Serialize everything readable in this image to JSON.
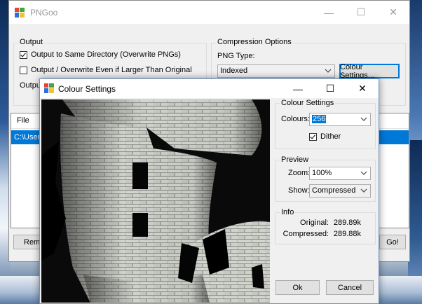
{
  "main_window": {
    "title": "PNGoo",
    "output_group": {
      "title": "Output",
      "same_dir_label": "Output to Same Directory (Overwrite PNGs)",
      "same_dir_checked": true,
      "overwrite_larger_label": "Output / Overwrite Even if Larger Than Original",
      "overwrite_larger_checked": false,
      "output_dir_label": "Output"
    },
    "compression_group": {
      "title": "Compression Options",
      "png_type_label": "PNG Type:",
      "png_type_value": "Indexed",
      "colour_settings_button": "Colour Settings..."
    },
    "file_list": {
      "column_header": "File",
      "rows": [
        "C:\\Users"
      ]
    },
    "remove_button": "Remo",
    "go_button": "Go!"
  },
  "dialog": {
    "title": "Colour Settings",
    "colour_settings": {
      "title": "Colour Settings",
      "colours_label": "Colours:",
      "colours_value": "256",
      "dither_label": "Dither",
      "dither_checked": true
    },
    "preview_group": {
      "title": "Preview",
      "zoom_label": "Zoom:",
      "zoom_value": "100%",
      "show_label": "Show:",
      "show_value": "Compressed"
    },
    "info_group": {
      "title": "Info",
      "original_label": "Original:",
      "original_value": "289.89k",
      "compressed_label": "Compressed:",
      "compressed_value": "289.88k"
    },
    "ok_button": "Ok",
    "cancel_button": "Cancel"
  },
  "colors": {
    "accent": "#0078d7",
    "window_bg": "#f0f0f0",
    "selection_bg": "#0078d7"
  }
}
